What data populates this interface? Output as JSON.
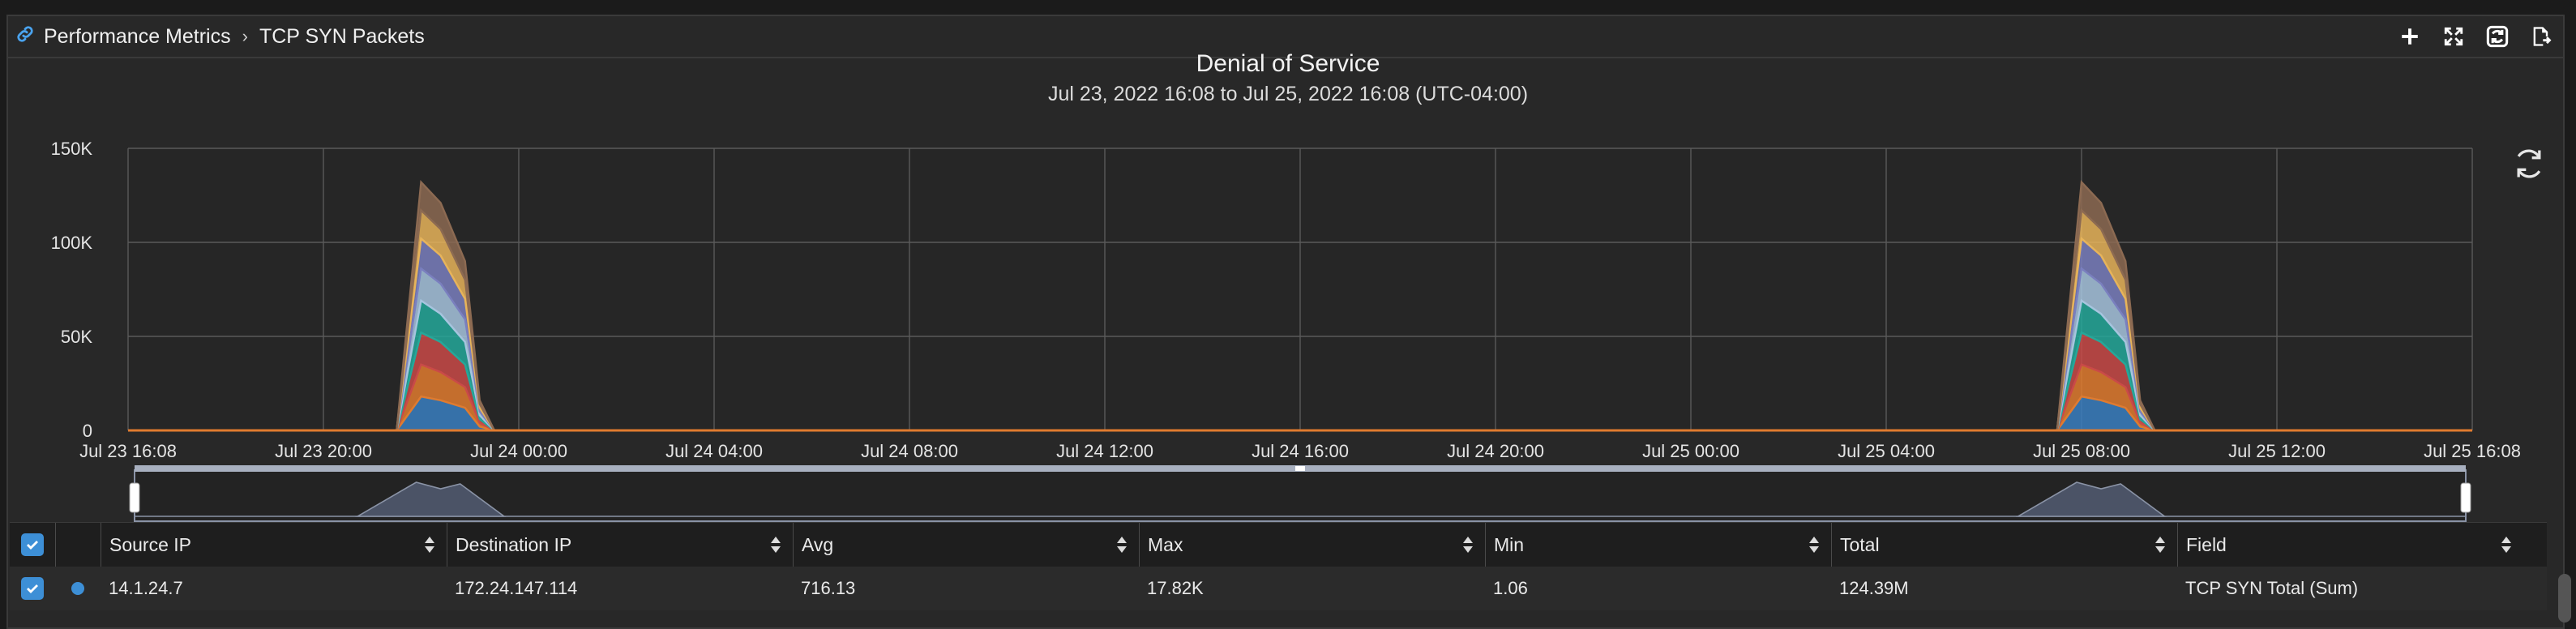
{
  "breadcrumb": {
    "parent": "Performance Metrics",
    "current": "TCP SYN Packets"
  },
  "toolbar": {
    "icons": [
      "plus-icon",
      "expand-icon",
      "refresh-icon",
      "export-icon"
    ]
  },
  "chart_data": {
    "type": "area",
    "title": "Denial of Service",
    "subtitle": "Jul 23, 2022 16:08 to Jul 25, 2022 16:08 (UTC-04:00)",
    "xlabel": "",
    "ylabel": "",
    "ylim": [
      0,
      150000
    ],
    "y_ticks": [
      {
        "value": 0,
        "label": "0"
      },
      {
        "value": 50000,
        "label": "50K"
      },
      {
        "value": 100000,
        "label": "100K"
      },
      {
        "value": 150000,
        "label": "150K"
      }
    ],
    "x_ticks": [
      {
        "hours": 0,
        "label": "Jul 23 16:08"
      },
      {
        "hours": 4,
        "label": "Jul 23 20:00"
      },
      {
        "hours": 8,
        "label": "Jul 24 00:00"
      },
      {
        "hours": 12,
        "label": "Jul 24 04:00"
      },
      {
        "hours": 16,
        "label": "Jul 24 08:00"
      },
      {
        "hours": 20,
        "label": "Jul 24 12:00"
      },
      {
        "hours": 24,
        "label": "Jul 24 16:00"
      },
      {
        "hours": 28,
        "label": "Jul 24 20:00"
      },
      {
        "hours": 32,
        "label": "Jul 25 00:00"
      },
      {
        "hours": 36,
        "label": "Jul 25 04:00"
      },
      {
        "hours": 40,
        "label": "Jul 25 08:00"
      },
      {
        "hours": 44,
        "label": "Jul 25 12:00"
      },
      {
        "hours": 48,
        "label": "Jul 25 16:08"
      }
    ],
    "x": [
      0,
      5.5,
      6.0,
      6.4,
      6.9,
      7.2,
      7.5,
      48
    ],
    "x2": [
      0,
      39.5,
      40.0,
      40.4,
      40.9,
      41.2,
      41.5,
      48
    ],
    "grid": true,
    "stacked": true,
    "series": [
      {
        "color": "#3a7fc1",
        "values": [
          0,
          0,
          18000,
          16000,
          12000,
          2000,
          0,
          0
        ]
      },
      {
        "color": "#e07b2f",
        "values": [
          0,
          0,
          17000,
          15000,
          11000,
          2000,
          0,
          0
        ]
      },
      {
        "color": "#c94a48",
        "values": [
          0,
          0,
          17000,
          16000,
          12000,
          2000,
          0,
          0
        ]
      },
      {
        "color": "#24a89a",
        "values": [
          0,
          0,
          17000,
          15000,
          12000,
          2000,
          0,
          0
        ]
      },
      {
        "color": "#a7c4de",
        "values": [
          0,
          0,
          17000,
          16000,
          12000,
          2000,
          0,
          0
        ]
      },
      {
        "color": "#7a7fbe",
        "values": [
          0,
          0,
          16000,
          15000,
          11000,
          2000,
          0,
          0
        ]
      },
      {
        "color": "#e7b45a",
        "values": [
          0,
          0,
          15000,
          14000,
          10000,
          2000,
          0,
          0
        ]
      },
      {
        "color": "#8c6a52",
        "values": [
          0,
          0,
          15000,
          14000,
          10000,
          2000,
          0,
          0
        ]
      }
    ]
  },
  "table": {
    "columns": [
      "Source IP",
      "Destination IP",
      "Avg",
      "Max",
      "Min",
      "Total",
      "Field"
    ],
    "rows": [
      {
        "series_color": "#3d8fd6",
        "cells": [
          "14.1.24.7",
          "172.24.147.114",
          "716.13",
          "17.82K",
          "1.06",
          "124.39M",
          "TCP SYN Total (Sum)"
        ]
      }
    ]
  }
}
